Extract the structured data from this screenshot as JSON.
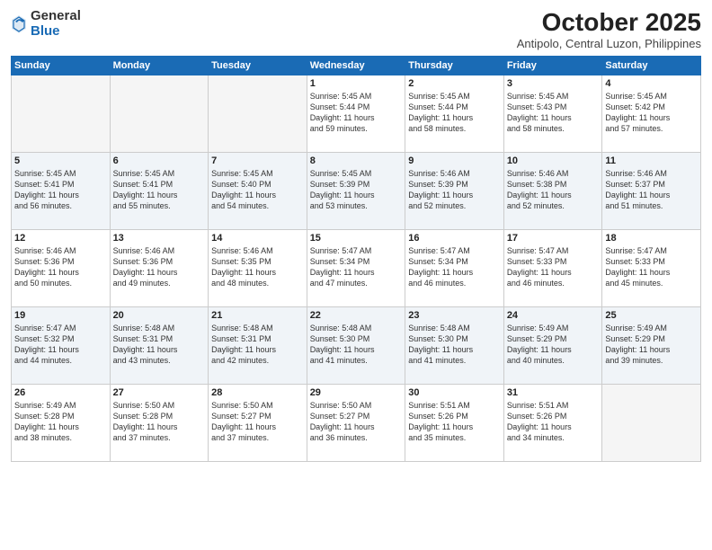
{
  "header": {
    "logo_general": "General",
    "logo_blue": "Blue",
    "month": "October 2025",
    "location": "Antipolo, Central Luzon, Philippines"
  },
  "weekdays": [
    "Sunday",
    "Monday",
    "Tuesday",
    "Wednesday",
    "Thursday",
    "Friday",
    "Saturday"
  ],
  "weeks": [
    [
      {
        "day": "",
        "info": ""
      },
      {
        "day": "",
        "info": ""
      },
      {
        "day": "",
        "info": ""
      },
      {
        "day": "1",
        "info": "Sunrise: 5:45 AM\nSunset: 5:44 PM\nDaylight: 11 hours\nand 59 minutes."
      },
      {
        "day": "2",
        "info": "Sunrise: 5:45 AM\nSunset: 5:44 PM\nDaylight: 11 hours\nand 58 minutes."
      },
      {
        "day": "3",
        "info": "Sunrise: 5:45 AM\nSunset: 5:43 PM\nDaylight: 11 hours\nand 58 minutes."
      },
      {
        "day": "4",
        "info": "Sunrise: 5:45 AM\nSunset: 5:42 PM\nDaylight: 11 hours\nand 57 minutes."
      }
    ],
    [
      {
        "day": "5",
        "info": "Sunrise: 5:45 AM\nSunset: 5:41 PM\nDaylight: 11 hours\nand 56 minutes."
      },
      {
        "day": "6",
        "info": "Sunrise: 5:45 AM\nSunset: 5:41 PM\nDaylight: 11 hours\nand 55 minutes."
      },
      {
        "day": "7",
        "info": "Sunrise: 5:45 AM\nSunset: 5:40 PM\nDaylight: 11 hours\nand 54 minutes."
      },
      {
        "day": "8",
        "info": "Sunrise: 5:45 AM\nSunset: 5:39 PM\nDaylight: 11 hours\nand 53 minutes."
      },
      {
        "day": "9",
        "info": "Sunrise: 5:46 AM\nSunset: 5:39 PM\nDaylight: 11 hours\nand 52 minutes."
      },
      {
        "day": "10",
        "info": "Sunrise: 5:46 AM\nSunset: 5:38 PM\nDaylight: 11 hours\nand 52 minutes."
      },
      {
        "day": "11",
        "info": "Sunrise: 5:46 AM\nSunset: 5:37 PM\nDaylight: 11 hours\nand 51 minutes."
      }
    ],
    [
      {
        "day": "12",
        "info": "Sunrise: 5:46 AM\nSunset: 5:36 PM\nDaylight: 11 hours\nand 50 minutes."
      },
      {
        "day": "13",
        "info": "Sunrise: 5:46 AM\nSunset: 5:36 PM\nDaylight: 11 hours\nand 49 minutes."
      },
      {
        "day": "14",
        "info": "Sunrise: 5:46 AM\nSunset: 5:35 PM\nDaylight: 11 hours\nand 48 minutes."
      },
      {
        "day": "15",
        "info": "Sunrise: 5:47 AM\nSunset: 5:34 PM\nDaylight: 11 hours\nand 47 minutes."
      },
      {
        "day": "16",
        "info": "Sunrise: 5:47 AM\nSunset: 5:34 PM\nDaylight: 11 hours\nand 46 minutes."
      },
      {
        "day": "17",
        "info": "Sunrise: 5:47 AM\nSunset: 5:33 PM\nDaylight: 11 hours\nand 46 minutes."
      },
      {
        "day": "18",
        "info": "Sunrise: 5:47 AM\nSunset: 5:33 PM\nDaylight: 11 hours\nand 45 minutes."
      }
    ],
    [
      {
        "day": "19",
        "info": "Sunrise: 5:47 AM\nSunset: 5:32 PM\nDaylight: 11 hours\nand 44 minutes."
      },
      {
        "day": "20",
        "info": "Sunrise: 5:48 AM\nSunset: 5:31 PM\nDaylight: 11 hours\nand 43 minutes."
      },
      {
        "day": "21",
        "info": "Sunrise: 5:48 AM\nSunset: 5:31 PM\nDaylight: 11 hours\nand 42 minutes."
      },
      {
        "day": "22",
        "info": "Sunrise: 5:48 AM\nSunset: 5:30 PM\nDaylight: 11 hours\nand 41 minutes."
      },
      {
        "day": "23",
        "info": "Sunrise: 5:48 AM\nSunset: 5:30 PM\nDaylight: 11 hours\nand 41 minutes."
      },
      {
        "day": "24",
        "info": "Sunrise: 5:49 AM\nSunset: 5:29 PM\nDaylight: 11 hours\nand 40 minutes."
      },
      {
        "day": "25",
        "info": "Sunrise: 5:49 AM\nSunset: 5:29 PM\nDaylight: 11 hours\nand 39 minutes."
      }
    ],
    [
      {
        "day": "26",
        "info": "Sunrise: 5:49 AM\nSunset: 5:28 PM\nDaylight: 11 hours\nand 38 minutes."
      },
      {
        "day": "27",
        "info": "Sunrise: 5:50 AM\nSunset: 5:28 PM\nDaylight: 11 hours\nand 37 minutes."
      },
      {
        "day": "28",
        "info": "Sunrise: 5:50 AM\nSunset: 5:27 PM\nDaylight: 11 hours\nand 37 minutes."
      },
      {
        "day": "29",
        "info": "Sunrise: 5:50 AM\nSunset: 5:27 PM\nDaylight: 11 hours\nand 36 minutes."
      },
      {
        "day": "30",
        "info": "Sunrise: 5:51 AM\nSunset: 5:26 PM\nDaylight: 11 hours\nand 35 minutes."
      },
      {
        "day": "31",
        "info": "Sunrise: 5:51 AM\nSunset: 5:26 PM\nDaylight: 11 hours\nand 34 minutes."
      },
      {
        "day": "",
        "info": ""
      }
    ]
  ]
}
